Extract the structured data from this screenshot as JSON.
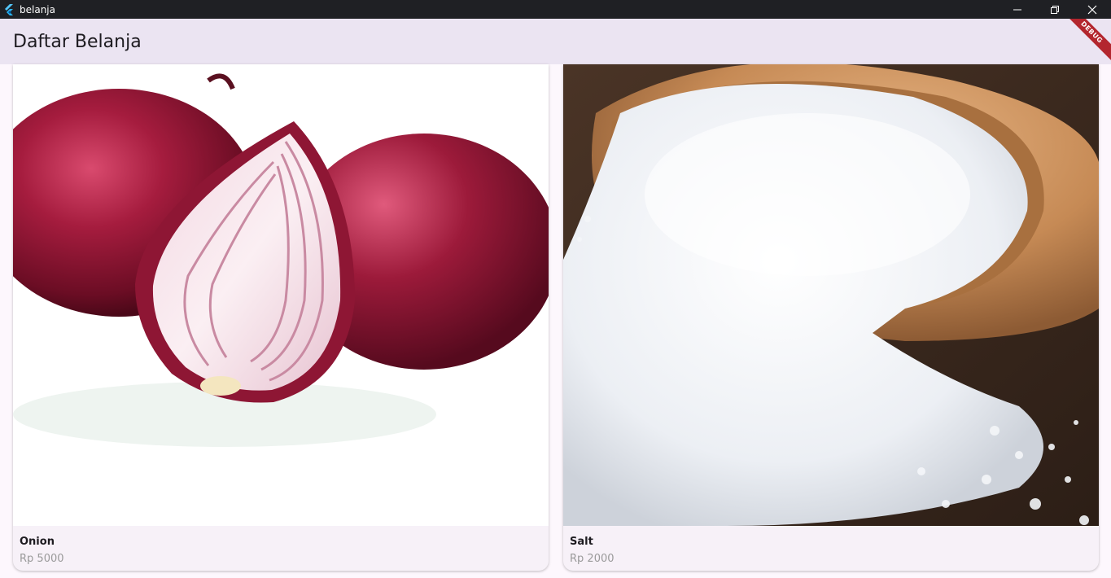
{
  "window": {
    "title": "belanja",
    "controls": [
      "minimize-icon",
      "restore-icon",
      "close-icon"
    ]
  },
  "appbar": {
    "title": "Daftar Belanja",
    "background": "#ebe4f2"
  },
  "debug_banner": "DEBUG",
  "items": [
    {
      "name": "Onion",
      "price": "Rp 5000",
      "image": "onion-photo"
    },
    {
      "name": "Salt",
      "price": "Rp 2000",
      "image": "salt-photo"
    }
  ],
  "colors": {
    "titlebar": "#1f2024",
    "card_background": "#f7f1f8",
    "price_text": "#9a9a9a",
    "debug_ribbon": "#b3262e"
  }
}
